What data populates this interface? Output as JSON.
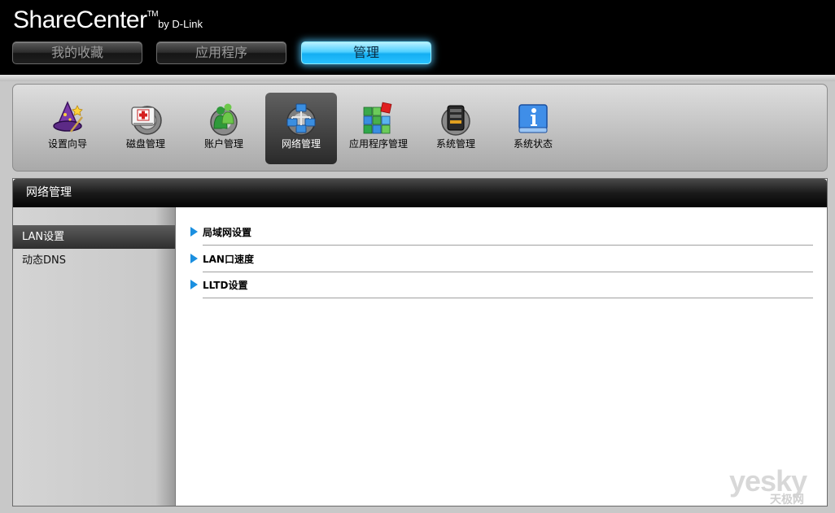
{
  "header": {
    "logo_main": "ShareCenter",
    "logo_tm": "TM",
    "logo_by": "by D-Link",
    "tabs": [
      {
        "label": "我的收藏",
        "active": false
      },
      {
        "label": "应用程序",
        "active": false
      },
      {
        "label": "管理",
        "active": true
      }
    ]
  },
  "toolbar": {
    "items": [
      {
        "label": "设置向导",
        "icon": "wizard-icon",
        "active": false
      },
      {
        "label": "磁盘管理",
        "icon": "disk-icon",
        "active": false
      },
      {
        "label": "账户管理",
        "icon": "account-icon",
        "active": false
      },
      {
        "label": "网络管理",
        "icon": "network-icon",
        "active": true
      },
      {
        "label": "应用程序管理",
        "icon": "apps-icon",
        "active": false
      },
      {
        "label": "系统管理",
        "icon": "system-icon",
        "active": false
      },
      {
        "label": "系统状态",
        "icon": "info-icon",
        "active": false
      }
    ]
  },
  "panel": {
    "title": "网络管理",
    "sidebar": [
      {
        "label": "LAN设置",
        "active": true
      },
      {
        "label": "动态DNS",
        "active": false
      }
    ],
    "sections": [
      {
        "label": "局域网设置"
      },
      {
        "label": "LAN口速度"
      },
      {
        "label": "LLTD设置"
      }
    ]
  },
  "watermark": {
    "main": "yesky",
    "sub": "天极网"
  },
  "colors": {
    "accent": "#1a8fe0",
    "active_tab": "#27c2ff"
  }
}
